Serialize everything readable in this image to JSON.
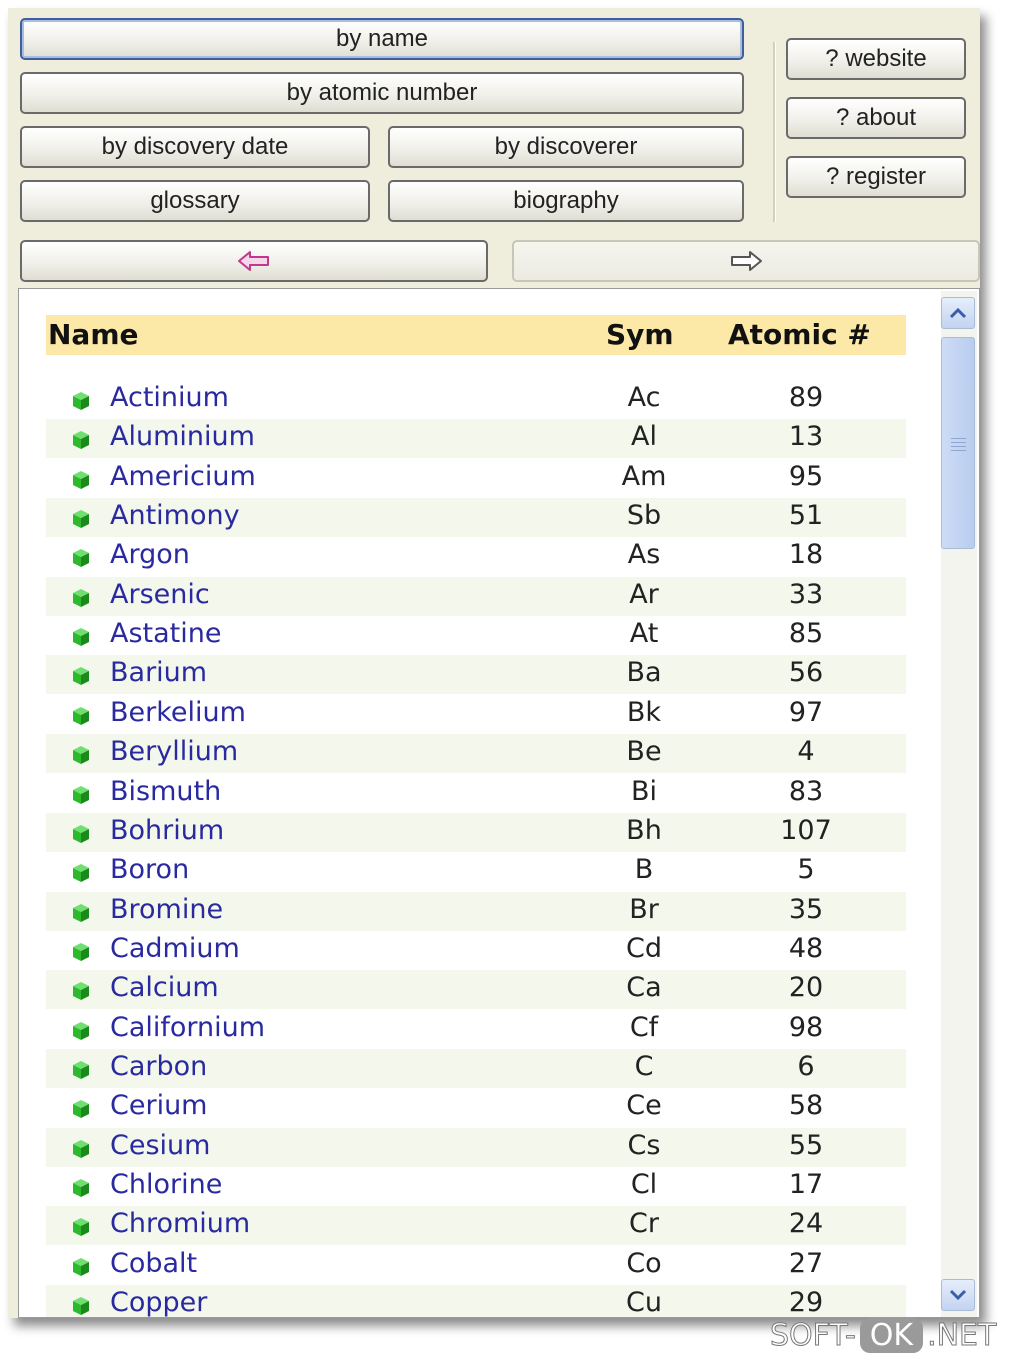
{
  "nav": {
    "by_name": "by name",
    "by_atomic_number": "by atomic number",
    "by_discovery_date": "by discovery date",
    "by_discoverer": "by discoverer",
    "glossary": "glossary",
    "biography": "biography"
  },
  "help": {
    "website": "? website",
    "about": "? about",
    "register": "? register"
  },
  "history": {
    "back_icon": "left-arrow-icon",
    "forward_icon": "right-arrow-icon"
  },
  "table": {
    "headers": {
      "name": "Name",
      "symbol": "Sym",
      "atomic": "Atomic #"
    },
    "rows": [
      {
        "name": "Actinium",
        "sym": "Ac",
        "num": "89"
      },
      {
        "name": "Aluminium",
        "sym": "Al",
        "num": "13"
      },
      {
        "name": "Americium",
        "sym": "Am",
        "num": "95"
      },
      {
        "name": "Antimony",
        "sym": "Sb",
        "num": "51"
      },
      {
        "name": "Argon",
        "sym": "As",
        "num": "18"
      },
      {
        "name": "Arsenic",
        "sym": "Ar",
        "num": "33"
      },
      {
        "name": "Astatine",
        "sym": "At",
        "num": "85"
      },
      {
        "name": "Barium",
        "sym": "Ba",
        "num": "56"
      },
      {
        "name": "Berkelium",
        "sym": "Bk",
        "num": "97"
      },
      {
        "name": "Beryllium",
        "sym": "Be",
        "num": "4"
      },
      {
        "name": "Bismuth",
        "sym": "Bi",
        "num": "83"
      },
      {
        "name": "Bohrium",
        "sym": "Bh",
        "num": "107"
      },
      {
        "name": "Boron",
        "sym": "B",
        "num": "5"
      },
      {
        "name": "Bromine",
        "sym": "Br",
        "num": "35"
      },
      {
        "name": "Cadmium",
        "sym": "Cd",
        "num": "48"
      },
      {
        "name": "Calcium",
        "sym": "Ca",
        "num": "20"
      },
      {
        "name": "Californium",
        "sym": "Cf",
        "num": "98"
      },
      {
        "name": "Carbon",
        "sym": "C",
        "num": "6"
      },
      {
        "name": "Cerium",
        "sym": "Ce",
        "num": "58"
      },
      {
        "name": "Cesium",
        "sym": "Cs",
        "num": "55"
      },
      {
        "name": "Chlorine",
        "sym": "Cl",
        "num": "17"
      },
      {
        "name": "Chromium",
        "sym": "Cr",
        "num": "24"
      },
      {
        "name": "Cobalt",
        "sym": "Co",
        "num": "27"
      },
      {
        "name": "Copper",
        "sym": "Cu",
        "num": "29"
      }
    ]
  },
  "watermark": {
    "left": "SOFT-",
    "mid": "OK",
    "right": ".NET"
  },
  "colors": {
    "header_bg": "#fde9a7",
    "link": "#2a2aa0",
    "alt_row": "#f3f7ec",
    "bullet": "#2db82d"
  }
}
